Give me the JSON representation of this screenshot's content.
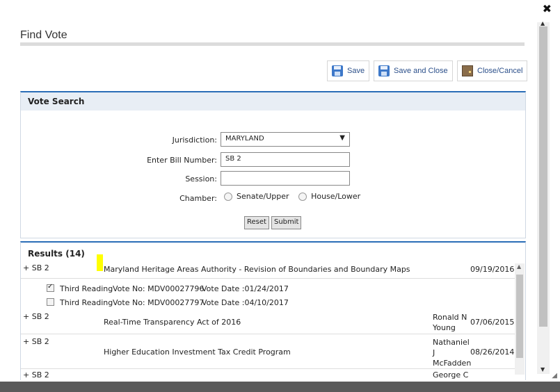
{
  "dialog": {
    "title": "Find Vote",
    "close_glyph": "✖"
  },
  "toolbar": {
    "save_label": "Save",
    "save_close_label": "Save and Close",
    "close_cancel_label": "Close/Cancel"
  },
  "search": {
    "header": "Vote Search",
    "jurisdiction_label": "Jurisdiction:",
    "jurisdiction_value": "MARYLAND",
    "bill_label": "Enter Bill Number:",
    "bill_value": "SB 2",
    "session_label": "Session:",
    "session_value": "",
    "chamber_label": "Chamber:",
    "chamber_options": [
      "Senate/Upper",
      "House/Lower"
    ],
    "reset_label": "Reset",
    "submit_label": "Submit"
  },
  "results": {
    "title": "Results (14)",
    "rows": [
      {
        "bill": "+ SB 2",
        "title": "Maryland Heritage Areas Authority - Revision of Boundaries and Boundary Maps",
        "sponsor": "",
        "date": "09/19/2016"
      },
      {
        "bill": "+ SB 2",
        "title": "Real-Time Transparency Act of 2016",
        "sponsor": "Ronald N Young",
        "date": "07/06/2015"
      },
      {
        "bill": "+ SB 2",
        "title": "Higher Education Investment Tax Credit Program",
        "sponsor": "Nathaniel J McFadden",
        "date": "08/26/2014"
      }
    ],
    "votes": [
      {
        "checked": true,
        "reading": "Third Reading",
        "vote_no": "Vote No: MDV00027796",
        "vote_date": "Vote Date :01/24/2017"
      },
      {
        "checked": false,
        "reading": "Third Reading",
        "vote_no": "Vote No: MDV00027797",
        "vote_date": "Vote Date :04/10/2017"
      }
    ],
    "partial_row": {
      "bill": "+ SB 2",
      "sponsor": "George C"
    }
  },
  "colors": {
    "accent": "#2a6db7",
    "link": "#2b4f8a",
    "highlight": "#ffff00"
  }
}
